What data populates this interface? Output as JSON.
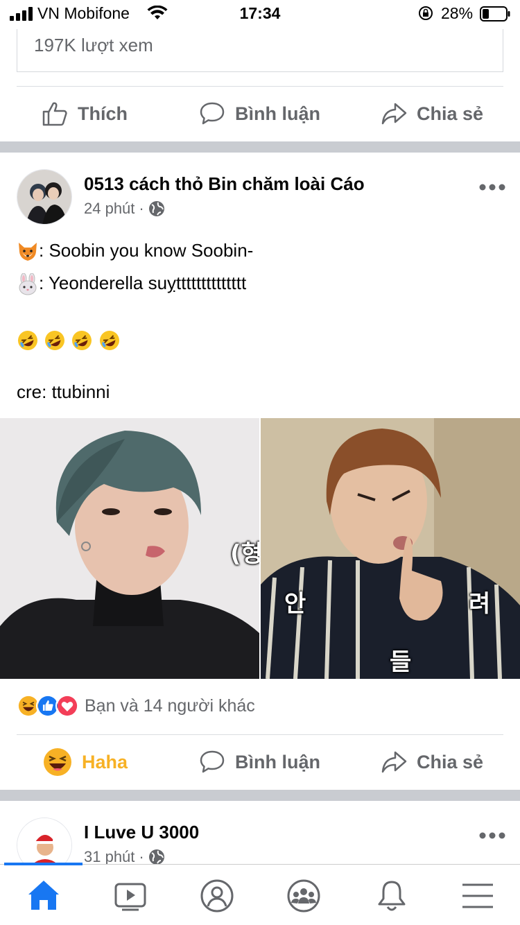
{
  "status_bar": {
    "carrier": "VN Mobifone",
    "time": "17:34",
    "battery": "28%"
  },
  "prev_post": {
    "views": "197K lượt xem",
    "actions": {
      "like": "Thích",
      "comment": "Bình luận",
      "share": "Chia sẻ"
    }
  },
  "post": {
    "title": "0513 cách thỏ Bin chăm loài Cáo",
    "time": "24 phút",
    "dot": "·",
    "lines": [
      ": Soobin you know Soobin-",
      ": Yeonderella suỵtttttttttttttt",
      "cre: ttubinni"
    ],
    "photo_captions": {
      "left": "(형",
      "right_1": "안",
      "right_2": "려",
      "right_3": "들"
    },
    "reactions_text": "Bạn và 14 người khác",
    "actions": {
      "reaction": "Haha",
      "comment": "Bình luận",
      "share": "Chia sẻ"
    }
  },
  "next_post": {
    "title": "I Luve U 3000",
    "time": "31 phút",
    "dot": "·"
  },
  "colors": {
    "accent": "#1877f2",
    "haha": "#f7b125",
    "secondary_text": "#65676b",
    "separator": "#c9ccd1"
  },
  "icons": {
    "status": [
      "signal-icon",
      "wifi-icon",
      "rotation-lock-icon",
      "battery-icon"
    ],
    "nav": [
      "home-icon",
      "watch-icon",
      "profile-icon",
      "groups-icon",
      "notifications-icon",
      "menu-icon"
    ]
  }
}
